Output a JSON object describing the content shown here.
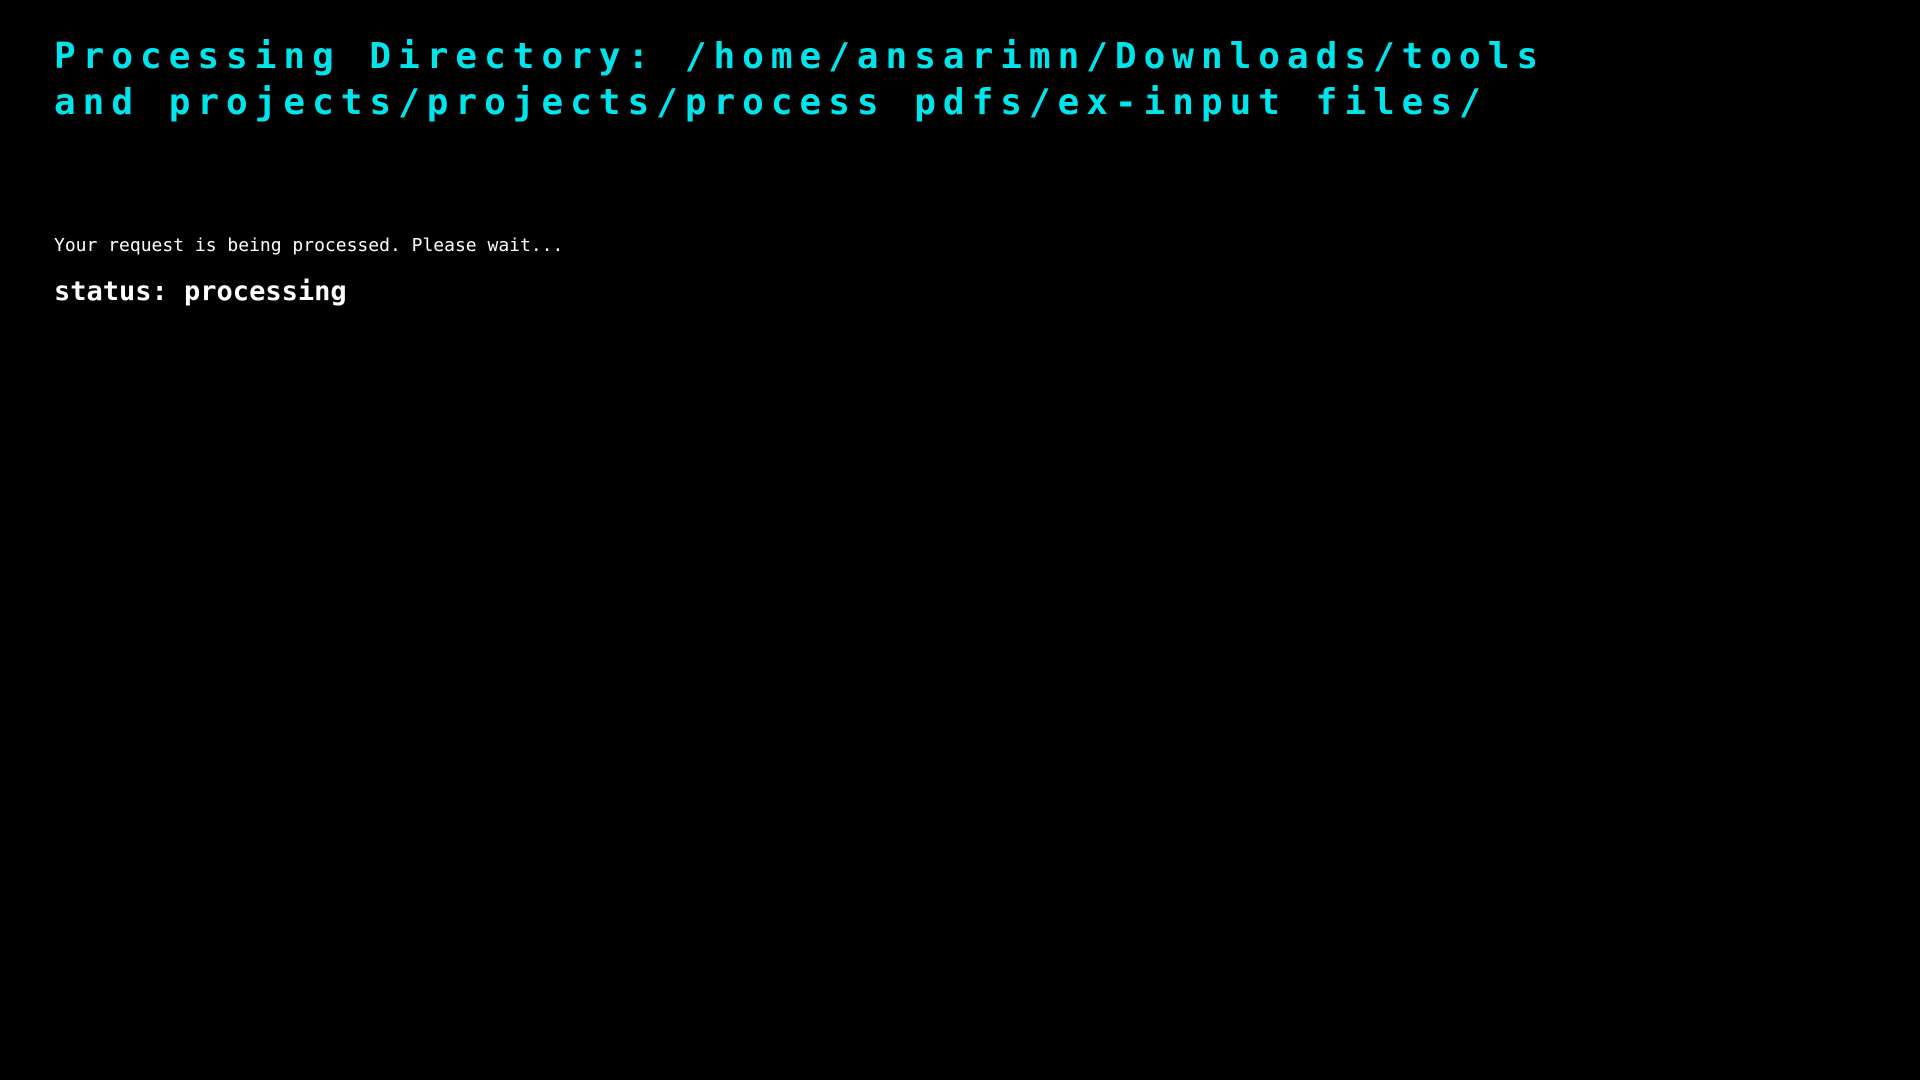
{
  "header": {
    "title": "Processing Directory: /home/ansarimn/Downloads/tools and projects/projects/process pdfs/ex-input files/"
  },
  "message": {
    "text": "Your request is being processed. Please wait..."
  },
  "status": {
    "text": "status: processing"
  },
  "colors": {
    "background": "#000000",
    "heading": "#00e5ec",
    "text": "#ffffff"
  }
}
